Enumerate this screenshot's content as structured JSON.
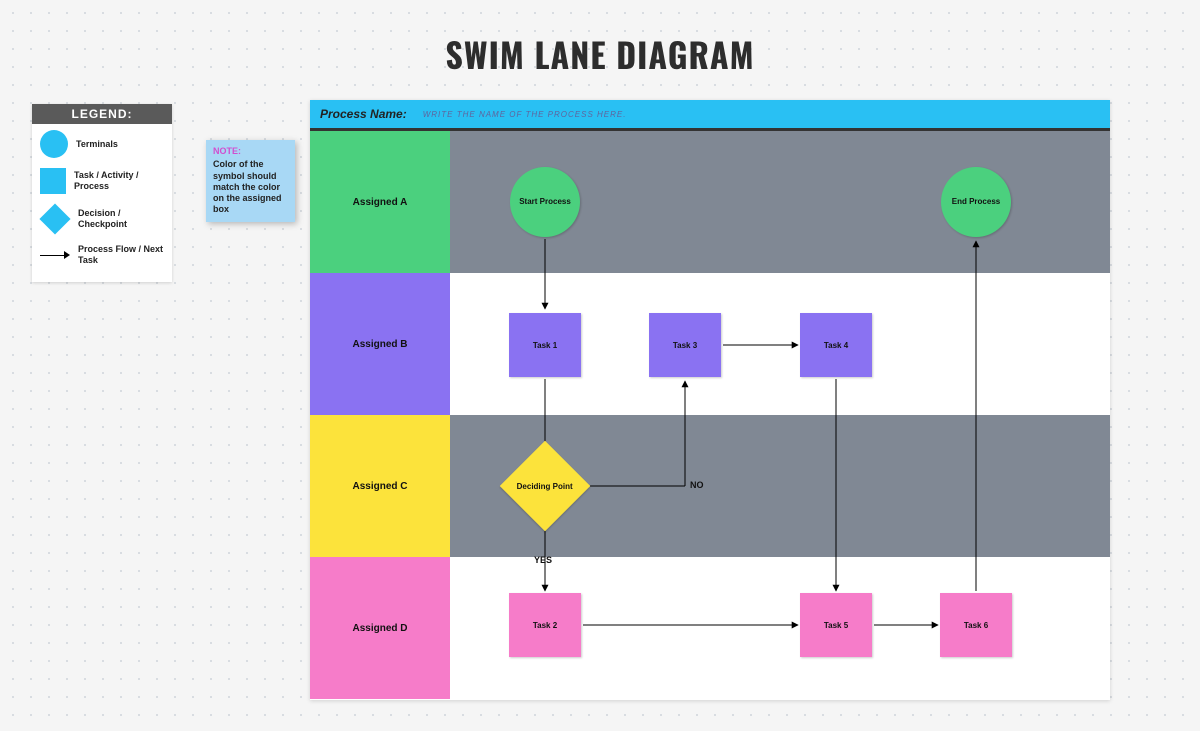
{
  "title": "SWIM LANE DIAGRAM",
  "legend": {
    "header": "LEGEND:",
    "terminals": "Terminals",
    "task": "Task / Activity / Process",
    "decision": "Decision / Checkpoint",
    "flow": "Process Flow / Next Task"
  },
  "note": {
    "title": "NOTE:",
    "body": "Color of the symbol should match the color on the assigned box"
  },
  "process": {
    "label": "Process Name:",
    "hint": "WRITE THE NAME OF THE PROCESS HERE."
  },
  "lanes": {
    "a": "Assigned A",
    "b": "Assigned B",
    "c": "Assigned C",
    "d": "Assigned D"
  },
  "nodes": {
    "start": "Start Process",
    "end": "End Process",
    "task1": "Task 1",
    "task3": "Task 3",
    "task4": "Task 4",
    "deciding": "Deciding Point",
    "task2": "Task 2",
    "task5": "Task 5",
    "task6": "Task 6"
  },
  "labels": {
    "no": "NO",
    "yes": "YES"
  },
  "colors": {
    "blue": "#29c0f3",
    "green": "#4bd07e",
    "purple": "#8a72f2",
    "yellow": "#fce33b",
    "pink": "#f67cc9",
    "grey": "#808894"
  }
}
